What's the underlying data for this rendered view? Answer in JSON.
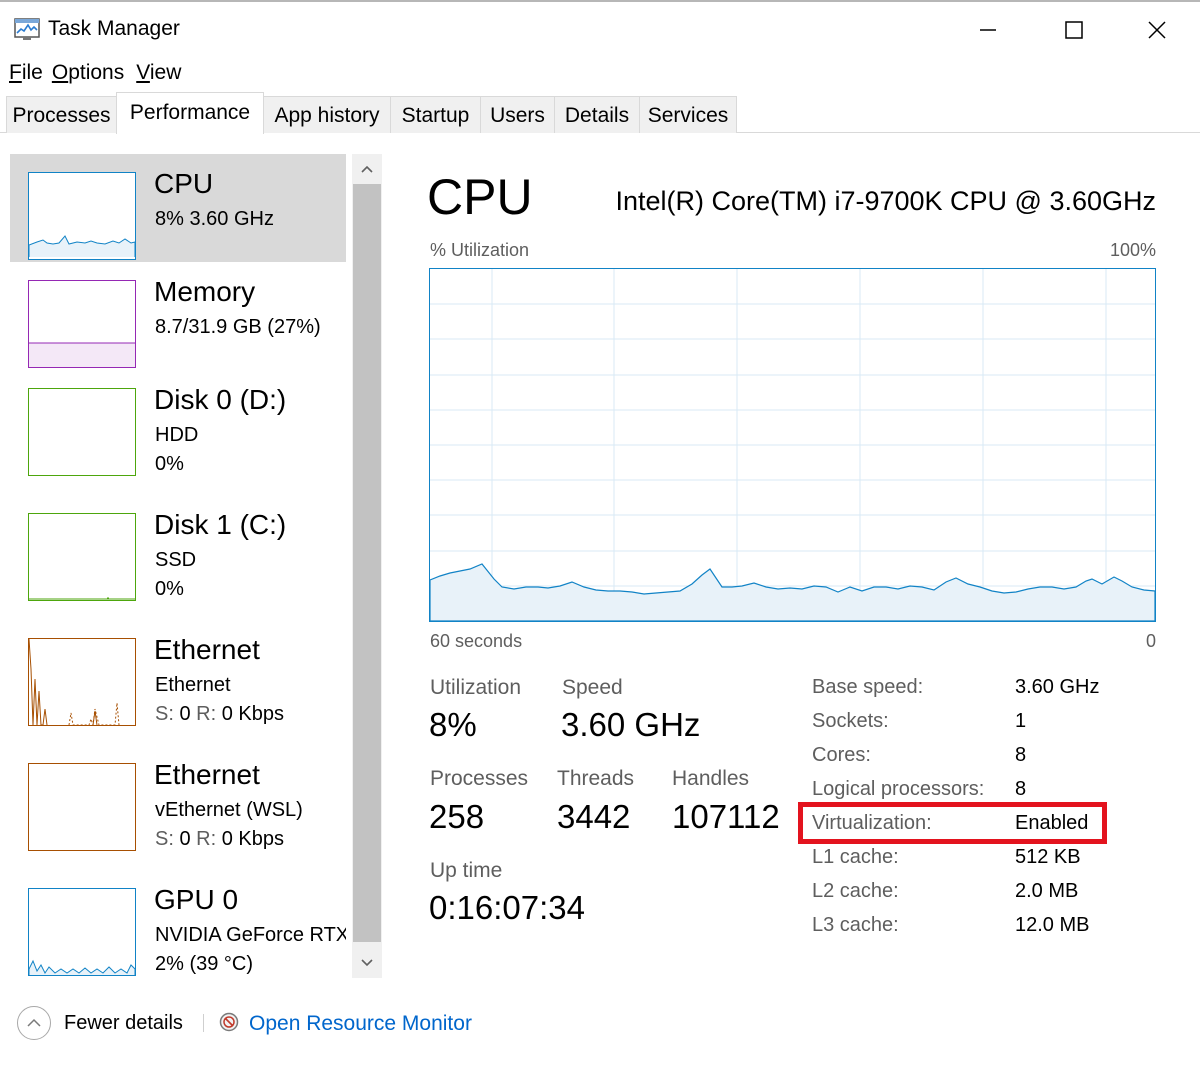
{
  "window": {
    "title": "Task Manager",
    "icon": "task-manager-icon"
  },
  "menu": [
    {
      "label": "File"
    },
    {
      "label": "Options"
    },
    {
      "label": "View"
    }
  ],
  "tabs": [
    {
      "label": "Processes"
    },
    {
      "label": "Performance",
      "active": true
    },
    {
      "label": "App history"
    },
    {
      "label": "Startup"
    },
    {
      "label": "Users"
    },
    {
      "label": "Details"
    },
    {
      "label": "Services"
    }
  ],
  "sidebar": {
    "items": [
      {
        "name": "CPU",
        "line1": "8%  3.60 GHz",
        "color": "#1183c6",
        "selected": true
      },
      {
        "name": "Memory",
        "line1": "8.7/31.9 GB (27%)",
        "color": "#9528b4"
      },
      {
        "name": "Disk 0 (D:)",
        "line1": "HDD",
        "line2": "0%",
        "color": "#4da60c"
      },
      {
        "name": "Disk 1 (C:)",
        "line1": "SSD",
        "line2": "0%",
        "color": "#4da60c"
      },
      {
        "name": "Ethernet",
        "line1": "Ethernet",
        "line2_label_s": "S:",
        "line2_value_s": "0",
        "line2_label_r": "R:",
        "line2_value_r": "0 Kbps",
        "color": "#a74f01"
      },
      {
        "name": "Ethernet",
        "line1": "vEthernet (WSL)",
        "line2_label_s": "S:",
        "line2_value_s": "0",
        "line2_label_r": "R:",
        "line2_value_r": "0 Kbps",
        "color": "#a74f01"
      },
      {
        "name": "GPU 0",
        "line1": "NVIDIA GeForce RTX",
        "line2": "2% (39 °C)",
        "color": "#1183c6"
      }
    ]
  },
  "cpu": {
    "title": "CPU",
    "model": "Intel(R) Core(TM) i7-9700K CPU @ 3.60GHz",
    "graph_label_left": "% Utilization",
    "graph_label_right": "100%",
    "graph_time_left": "60 seconds",
    "graph_time_right": "0",
    "graph_color": "#1183c6",
    "stats": {
      "utilization_label": "Utilization",
      "utilization_value": "8%",
      "speed_label": "Speed",
      "speed_value": "3.60 GHz",
      "processes_label": "Processes",
      "processes_value": "258",
      "threads_label": "Threads",
      "threads_value": "3442",
      "handles_label": "Handles",
      "handles_value": "107112",
      "uptime_label": "Up time",
      "uptime_value": "0:16:07:34"
    },
    "details": [
      {
        "label": "Base speed:",
        "value": "3.60 GHz"
      },
      {
        "label": "Sockets:",
        "value": "1"
      },
      {
        "label": "Cores:",
        "value": "8"
      },
      {
        "label": "Logical processors:",
        "value": "8"
      },
      {
        "label": "Virtualization:",
        "value": "Enabled",
        "highlighted": true
      },
      {
        "label": "L1 cache:",
        "value": "512 KB"
      },
      {
        "label": "L2 cache:",
        "value": "2.0 MB"
      },
      {
        "label": "L3 cache:",
        "value": "12.0 MB"
      }
    ],
    "highlight_color": "#e3131e"
  },
  "footer": {
    "fewer_details": "Fewer details",
    "resource_monitor": "Open Resource Monitor"
  }
}
